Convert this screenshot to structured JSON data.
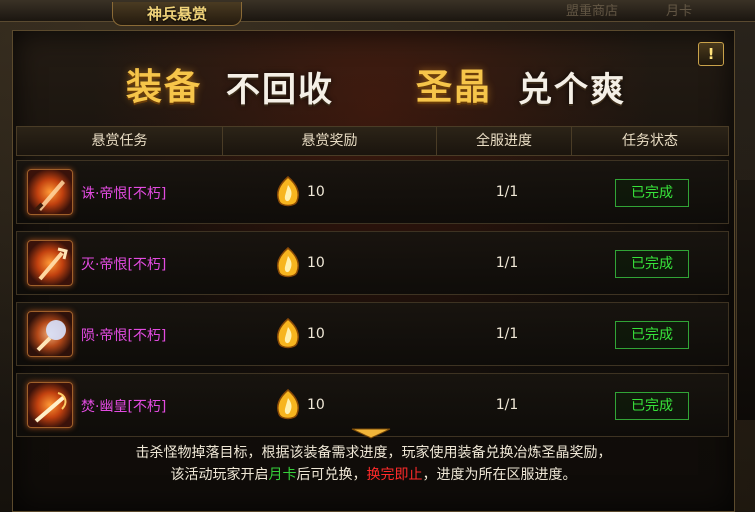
{
  "window": {
    "title": "神兵悬赏",
    "top_right_1": "盟重商店",
    "top_right_2": "月卡",
    "help": "!"
  },
  "banner": {
    "left_gold": "装备",
    "left_white": "不回收",
    "right_gold": "圣晶",
    "right_white": "兑个爽"
  },
  "table": {
    "headers": [
      "悬赏任务",
      "悬赏奖励",
      "全服进度",
      "任务状态"
    ],
    "rows": [
      {
        "name": "诛·帝恨[不朽]",
        "reward": "10",
        "progress": "1/1",
        "status": "已完成",
        "icon": "blade-weapon-icon"
      },
      {
        "name": "灭·帝恨[不朽]",
        "reward": "10",
        "progress": "1/1",
        "status": "已完成",
        "icon": "trident-weapon-icon"
      },
      {
        "name": "陨·帝恨[不朽]",
        "reward": "10",
        "progress": "1/1",
        "status": "已完成",
        "icon": "mace-weapon-icon"
      },
      {
        "name": "焚·幽皇[不朽]",
        "reward": "10",
        "progress": "1/1",
        "status": "已完成",
        "icon": "flame-blade-icon"
      }
    ]
  },
  "footer": {
    "line1": "击杀怪物掉落目标，根据该装备需求进度，玩家使用装备兑换冶炼圣晶奖励，",
    "line2_a": "该活动玩家开启",
    "line2_green": "月卡",
    "line2_b": "后可兑换，",
    "line2_red": "换完即止",
    "line2_c": "，进度为所在区服进度。"
  },
  "colors": {
    "accent_gold": "#f6c54a",
    "item_name_purple": "#e24be0",
    "status_green": "#37e23a",
    "warning_red": "#ff2a2a"
  }
}
